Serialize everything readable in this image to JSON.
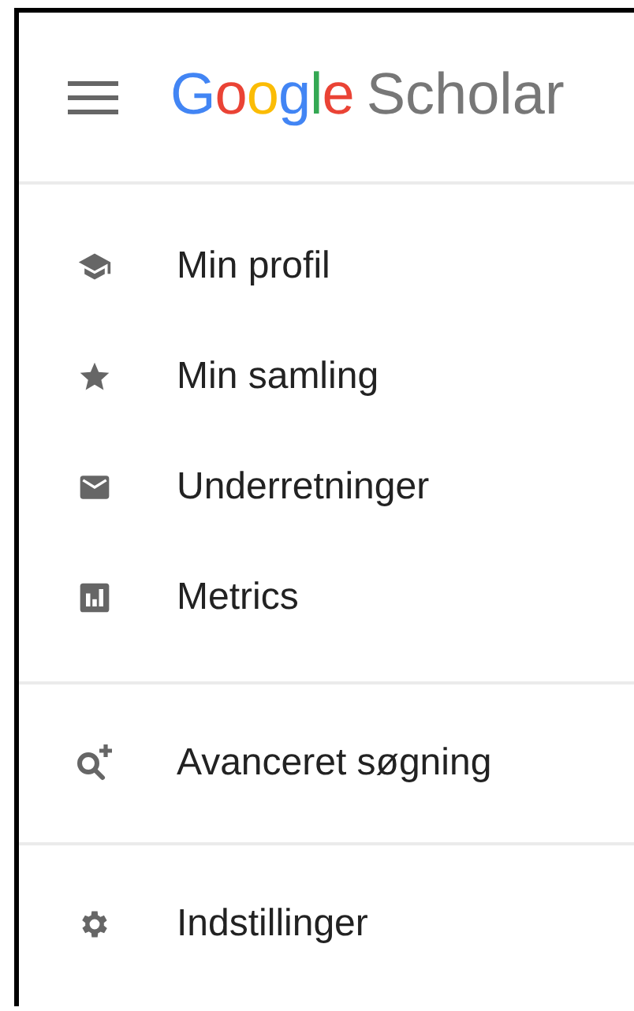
{
  "header": {
    "logo_brand": "Google",
    "logo_product": "Scholar"
  },
  "sections": [
    {
      "items": [
        {
          "label": "Min profil",
          "kind": "profile"
        },
        {
          "label": "Min samling",
          "kind": "library"
        },
        {
          "label": "Underretninger",
          "kind": "alerts"
        },
        {
          "label": "Metrics",
          "kind": "metrics"
        }
      ]
    },
    {
      "items": [
        {
          "label": "Avanceret søgning",
          "kind": "advanced"
        }
      ]
    },
    {
      "items": [
        {
          "label": "Indstillinger",
          "kind": "settings"
        }
      ]
    }
  ]
}
